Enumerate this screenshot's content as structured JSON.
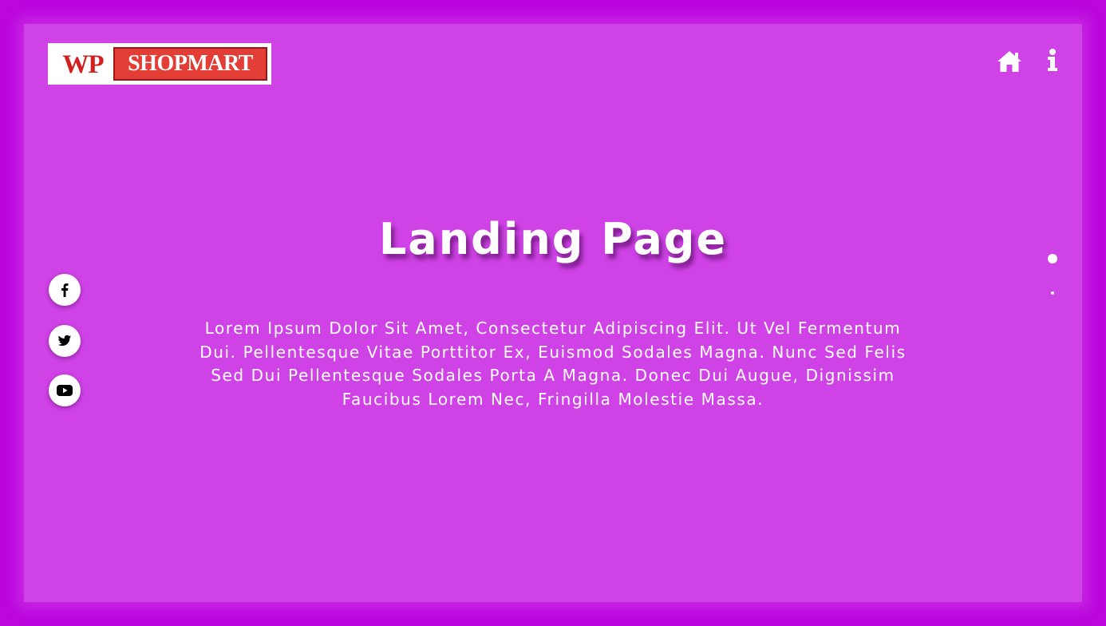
{
  "brand": {
    "logo_part1": "WP",
    "logo_part2": "SHOPMART"
  },
  "nav": {
    "icons": [
      "home-icon",
      "info-icon"
    ]
  },
  "hero": {
    "title": "Landing Page",
    "description": "Lorem Ipsum Dolor Sit Amet, Consectetur Adipiscing Elit. Ut Vel Fermentum Dui. Pellentesque Vitae Porttitor Ex, Euismod Sodales Magna. Nunc Sed Felis Sed Dui Pellentesque Sodales Porta A Magna. Donec Dui Augue, Dignissim Faucibus Lorem Nec, Fringilla Molestie Massa."
  },
  "social": {
    "icons": [
      "facebook-icon",
      "twitter-icon",
      "youtube-icon"
    ]
  },
  "pager": {
    "active_index": 0,
    "count": 2
  },
  "colors": {
    "outer_background": "#bb07de",
    "inner_background": "#cf42e6",
    "logo_red": "#e33d35",
    "text": "#ffffff"
  }
}
